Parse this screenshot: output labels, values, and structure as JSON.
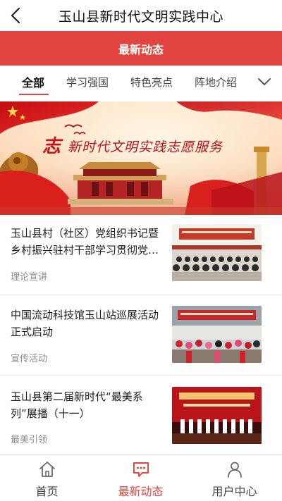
{
  "header": {
    "title": "玉山县新时代文明实践中心",
    "back_icon": "chevron-left-icon"
  },
  "section": {
    "title": "最新动态"
  },
  "tabs": [
    {
      "label": "全部",
      "active": true
    },
    {
      "label": "学习强国",
      "active": false
    },
    {
      "label": "特色亮点",
      "active": false
    },
    {
      "label": "阵地介绍",
      "active": false
    }
  ],
  "tabs_more_icon": "chevron-down-icon",
  "banner": {
    "title": "新时代文明实践志愿服务",
    "emblem_text": "志"
  },
  "news": [
    {
      "headline": "玉山县村（社区）党组织书记暨乡村振兴驻村干部学习贯彻党的二十大精神专题培训班",
      "category": "理论宣讲"
    },
    {
      "headline": "中国流动科技馆玉山站巡展活动正式启动",
      "category": "宣传活动"
    },
    {
      "headline": "玉山县第二届新时代“最美系列”展播（十一）",
      "category": "最美引领"
    }
  ],
  "bottom_nav": [
    {
      "label": "首页",
      "icon": "home-icon",
      "active": false
    },
    {
      "label": "最新动态",
      "icon": "message-icon",
      "active": true
    },
    {
      "label": "用户中心",
      "icon": "user-icon",
      "active": false
    }
  ],
  "colors": {
    "accent": "#e2443f",
    "text": "#1c1c1c",
    "muted": "#8a8a8a"
  }
}
